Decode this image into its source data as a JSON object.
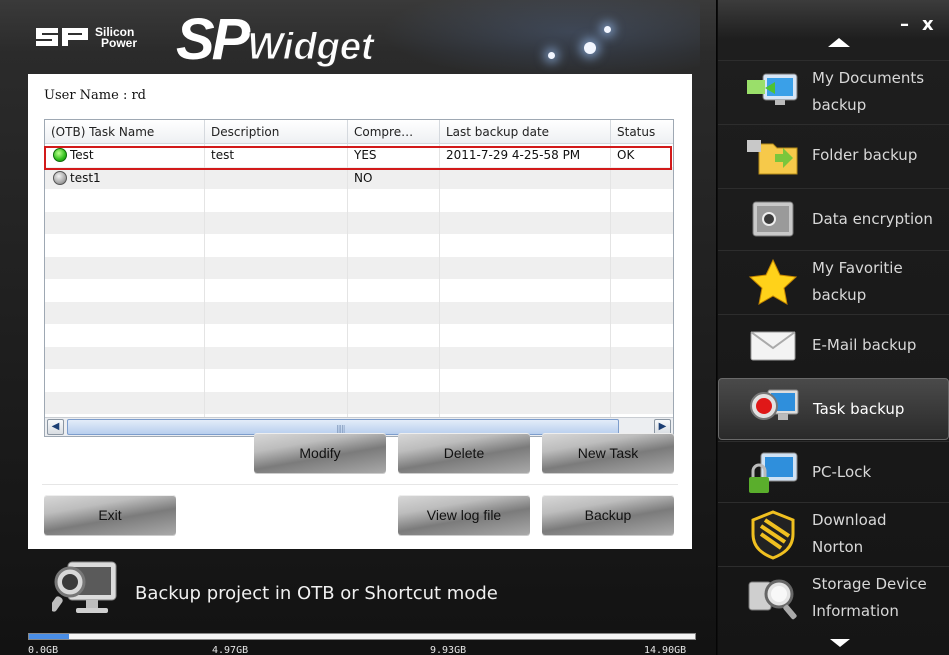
{
  "header": {
    "logo_line1": "Silicon",
    "logo_line2": "Power",
    "brand_sp": "SP",
    "brand_widget": "Widget"
  },
  "content": {
    "user_name": "User Name : rd",
    "table": {
      "columns": [
        "(OTB) Task Name",
        "Description",
        "Compre…",
        "Last backup date",
        "Status"
      ],
      "rows": [
        {
          "name": "Test",
          "description": "test",
          "compress": "YES",
          "last_backup": "2011-7-29 4-25-58 PM",
          "status": "OK",
          "state": "green"
        },
        {
          "name": "test1",
          "description": "",
          "compress": "NO",
          "last_backup": "",
          "status": "",
          "state": "gray"
        }
      ],
      "empty_rows": 11,
      "selected_row": 0
    },
    "buttons": {
      "modify": "Modify",
      "delete": "Delete",
      "new_task": "New Task",
      "exit": "Exit",
      "view_log": "View log file",
      "backup": "Backup"
    }
  },
  "footer": {
    "tip": "Backup project in OTB or Shortcut mode",
    "usage_fraction": 0.06,
    "ticks": [
      "0.0GB",
      "4.97GB",
      "9.93GB",
      "14.90GB"
    ]
  },
  "sidebar": {
    "minimize": "–",
    "close": "x",
    "active_index": 5,
    "items": [
      {
        "label_1": "My Documents",
        "label_2": "backup",
        "icon": "my-documents-icon"
      },
      {
        "label_1": "Folder backup",
        "label_2": "",
        "icon": "folder-icon"
      },
      {
        "label_1": "Data encryption",
        "label_2": "",
        "icon": "safe-icon"
      },
      {
        "label_1": "My Favoritie",
        "label_2": "backup",
        "icon": "star-icon"
      },
      {
        "label_1": "E-Mail backup",
        "label_2": "",
        "icon": "envelope-icon"
      },
      {
        "label_1": "Task backup",
        "label_2": "",
        "icon": "task-icon"
      },
      {
        "label_1": "PC-Lock",
        "label_2": "",
        "icon": "lock-icon"
      },
      {
        "label_1": "Download",
        "label_2": "Norton",
        "icon": "norton-shield-icon"
      },
      {
        "label_1": "Storage Device",
        "label_2": "Information",
        "icon": "storage-search-icon"
      }
    ]
  }
}
